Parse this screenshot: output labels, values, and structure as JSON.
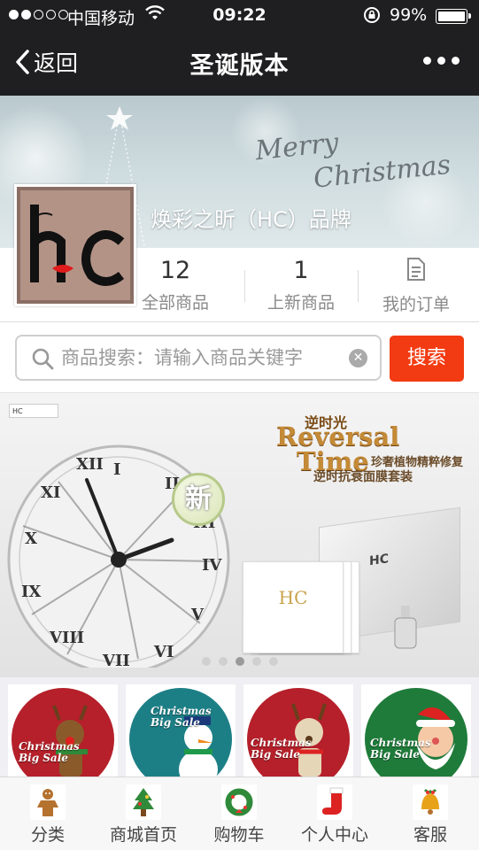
{
  "status_bar": {
    "carrier": "中国移动",
    "time": "09:22",
    "battery": "99%"
  },
  "nav": {
    "back_label": "返回",
    "title": "圣诞版本"
  },
  "shop": {
    "banner_text_line1": "Merry",
    "banner_text_line2": "Christmas",
    "brand_name": "焕彩之昕（HC）品牌",
    "stats": [
      {
        "value": "12",
        "label": "全部商品"
      },
      {
        "value": "1",
        "label": "上新商品"
      },
      {
        "value": "",
        "label": "我的订单"
      }
    ]
  },
  "search": {
    "placeholder": "商品搜索：请输入商品关键字",
    "button_label": "搜索"
  },
  "carousel": {
    "new_badge": "新",
    "headline_cn": "逆时光",
    "headline_en_1": "Reversal",
    "headline_en_2": "Time",
    "subtitle_1": "珍奢植物精粹修复",
    "subtitle_2": "逆时抗衰面膜套装",
    "brand_mark": "HC",
    "slide_count": 5,
    "active_slide": 2
  },
  "promo_tiles": [
    {
      "line1": "Christmas",
      "line2": "Big Sale",
      "bg": "#b5202a"
    },
    {
      "line1": "Christmas",
      "line2": "Big Sale",
      "bg": "#1d7f86"
    },
    {
      "line1": "Christmas",
      "line2": "Big Sale",
      "bg": "#b5202a"
    },
    {
      "line1": "Christmas",
      "line2": "Big Sale",
      "bg": "#1f7b3a"
    }
  ],
  "tabbar": {
    "items": [
      {
        "label": "分类",
        "icon": "gingerbread-icon"
      },
      {
        "label": "商城首页",
        "icon": "christmas-tree-icon"
      },
      {
        "label": "购物车",
        "icon": "wreath-icon"
      },
      {
        "label": "个人中心",
        "icon": "stocking-icon"
      },
      {
        "label": "客服",
        "icon": "bell-icon"
      }
    ]
  },
  "colors": {
    "nav_bg": "#1f1f21",
    "search_button": "#f23b12",
    "accent_red": "#e02020"
  }
}
